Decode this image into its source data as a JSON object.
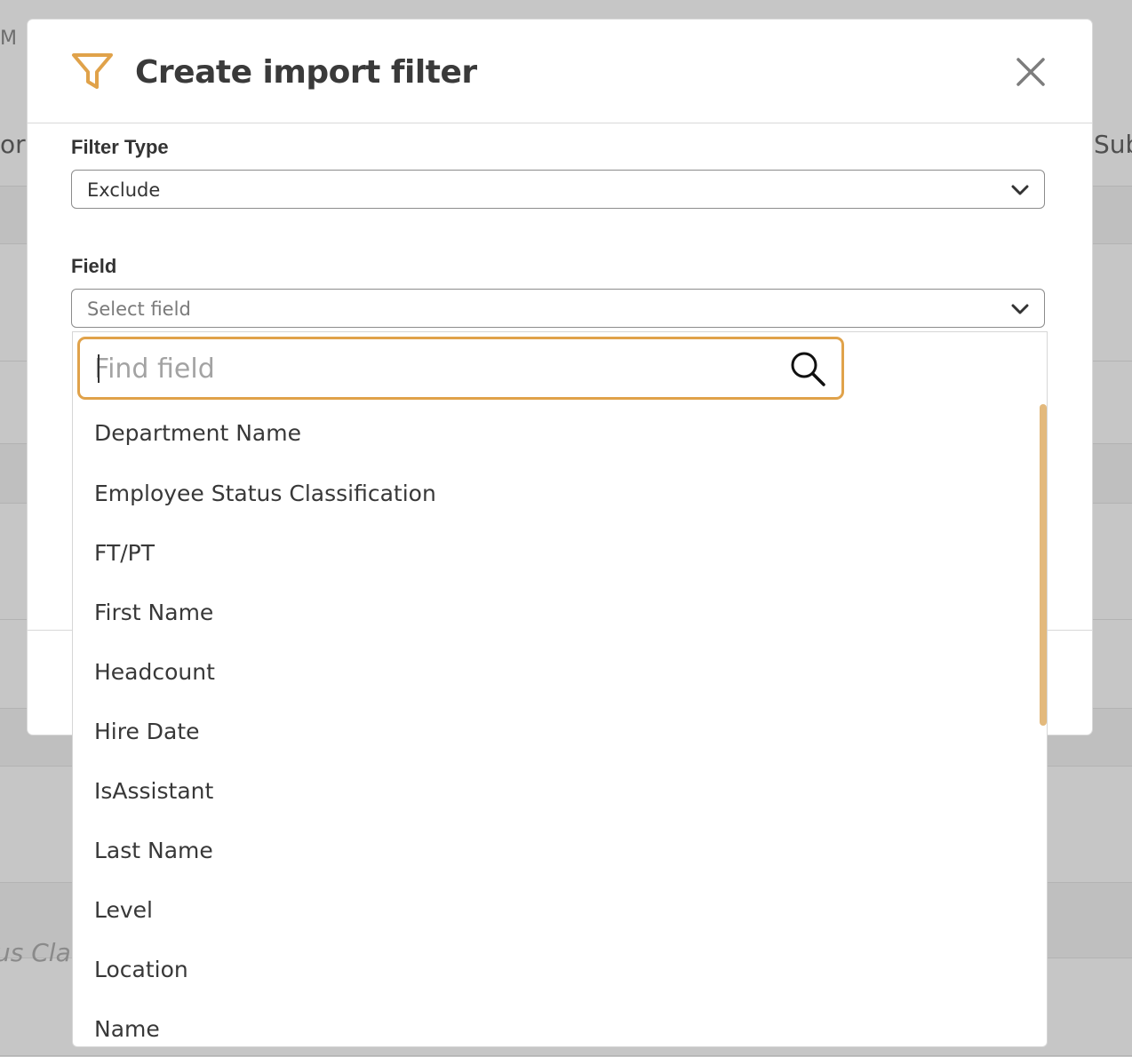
{
  "background": {
    "fragments": {
      "top_left_glyph": "M",
      "left_col_text": "or",
      "right_col_text": "Sub",
      "left_italic_text": "us Cla"
    }
  },
  "modal": {
    "title": "Create import filter",
    "header_icon": "filter-icon",
    "close_icon": "close-icon",
    "accent_color": "#E0A24A",
    "filter_type": {
      "label": "Filter Type",
      "value": "Exclude"
    },
    "field": {
      "label": "Field",
      "placeholder": "Select field"
    }
  },
  "dropdown": {
    "search": {
      "placeholder": "Find field",
      "value": ""
    },
    "options": [
      "Department Name",
      "Employee Status Classification",
      "FT/PT",
      "First Name",
      "Headcount",
      "Hire Date",
      "IsAssistant",
      "Last Name",
      "Level",
      "Location",
      "Name"
    ]
  }
}
